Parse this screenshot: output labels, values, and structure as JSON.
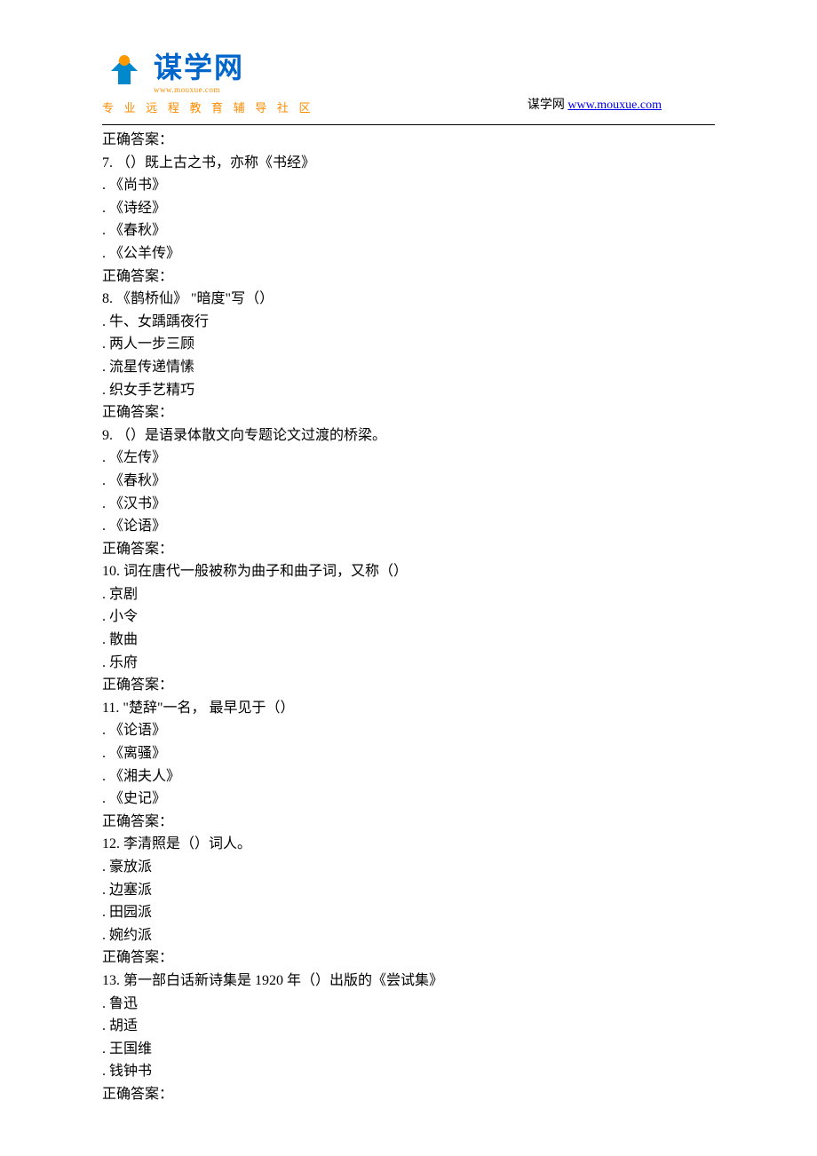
{
  "header": {
    "logo_name": "谋学网",
    "logo_sub": "www.mouxue.com",
    "tagline": "专 业 远 程 教 育 辅 导 社 区",
    "right_text": "谋学网",
    "right_link": "www.mouxue.com"
  },
  "answer_label": "正确答案：",
  "questions": [
    {
      "num": "7.",
      "text": "（）既上古之书，亦称《书经》",
      "options": [
        "《尚书》",
        "《诗经》",
        "《春秋》",
        "《公羊传》"
      ]
    },
    {
      "num": "8.",
      "text": "《鹊桥仙》 \"暗度\"写（）",
      "options": [
        "牛、女踽踽夜行",
        "两人一步三顾",
        "流星传递情愫",
        "织女手艺精巧"
      ]
    },
    {
      "num": "9.",
      "text": "（）是语录体散文向专题论文过渡的桥梁。",
      "options": [
        "《左传》",
        "《春秋》",
        "《汉书》",
        "《论语》"
      ]
    },
    {
      "num": "10.",
      "text": "词在唐代一般被称为曲子和曲子词，又称（）",
      "options": [
        "京剧",
        "小令",
        "散曲",
        "乐府"
      ]
    },
    {
      "num": "11.",
      "text": "\"楚辞\"一名， 最早见于（）",
      "options": [
        "《论语》",
        "《离骚》",
        "《湘夫人》",
        "《史记》"
      ]
    },
    {
      "num": "12.",
      "text": "李清照是（）词人。",
      "options": [
        "豪放派",
        "边塞派",
        "田园派",
        "婉约派"
      ]
    },
    {
      "num": "13.",
      "text": "第一部白话新诗集是 1920 年（）出版的《尝试集》",
      "options": [
        "鲁迅",
        "胡适",
        "王国维",
        "钱钟书"
      ]
    }
  ]
}
